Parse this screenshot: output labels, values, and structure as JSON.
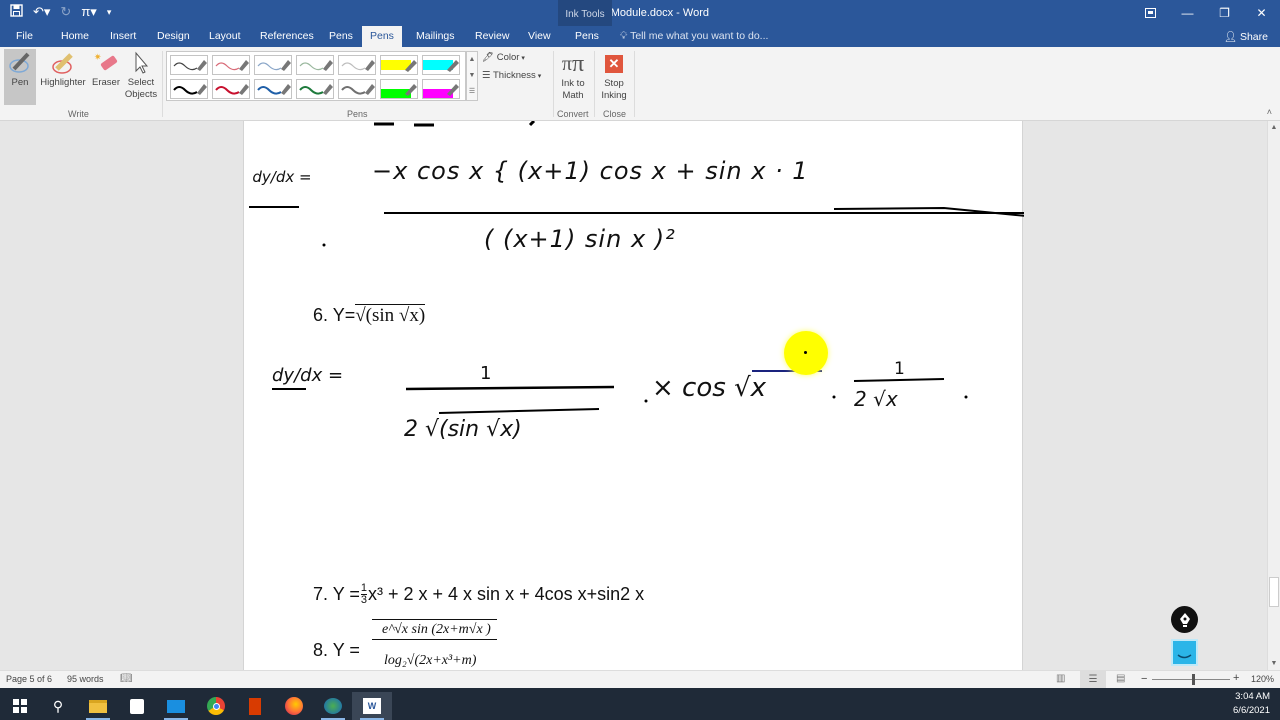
{
  "window": {
    "title": "2.Class Module.docx - Word",
    "context_tab_group": "Ink Tools",
    "controls": {
      "ribbon_display": "ribbon-display-icon",
      "minimize": "—",
      "restore": "❐",
      "close": "✕"
    }
  },
  "quick_access": {
    "save": "save-icon",
    "undo": "↶▾",
    "redo": "↻",
    "equation": "π▾",
    "customize": "▾"
  },
  "tabs": [
    {
      "label": "File"
    },
    {
      "label": "Home"
    },
    {
      "label": "Insert"
    },
    {
      "label": "Design"
    },
    {
      "label": "Layout"
    },
    {
      "label": "References"
    },
    {
      "label": "Pens"
    },
    {
      "label": "Pens",
      "active": true
    },
    {
      "label": "Mailings"
    },
    {
      "label": "Review"
    },
    {
      "label": "View"
    },
    {
      "label": "Pens"
    }
  ],
  "tell_me": {
    "placeholder": "Tell me what you want to do..."
  },
  "share_label": "Share",
  "ribbon": {
    "write": {
      "label": "Write",
      "buttons": [
        {
          "label": "Pen",
          "selected": true
        },
        {
          "label": "Highlighter"
        },
        {
          "label": "Eraser"
        },
        {
          "label": "Select Objects"
        }
      ]
    },
    "pens": {
      "label": "Pens",
      "row1": [
        "#444444",
        "#d96b78",
        "#8aa6c8",
        "#9ab89e",
        "#bdbdbd",
        "#ffff00",
        "#00ffff"
      ],
      "row2": [
        "#000000",
        "#c8102e",
        "#1f5fa8",
        "#1e7a3c",
        "#707070",
        "#00ff00",
        "#ff00ff"
      ],
      "highlighters": [
        5,
        6
      ],
      "color_label": "Color",
      "thickness_label": "Thickness"
    },
    "convert": {
      "label": "Convert",
      "button": "Ink to Math"
    },
    "close": {
      "label": "Close",
      "button": "Stop Inking"
    }
  },
  "document": {
    "ink_line1_lhs": "dy/dx =",
    "ink_line1_num": "−x cos x { (x+1) cos x + sin x · 1",
    "ink_line1_den": "( (x+1) sin x )²",
    "item6_label": "6. Y=",
    "item6_expr": "√(sin √x)",
    "ink_line2_lhs": "dy/dx =",
    "ink_line2_frac_num": "1",
    "ink_line2_frac_den": "2 √(sin √x)",
    "ink_line2_mid": "× cos √x",
    "ink_line2_frac2_num": "1",
    "ink_line2_frac2_den": "2 √x",
    "item7": "7. Y = ⅓x³ + 2 x + 4 x sin x + 4cos x+sin2 x",
    "item7_prefix": "7. Y = ",
    "item7_frac_num": "1",
    "item7_frac_den": "3",
    "item7_rest": "x³ + 2 x + 4 x sin x + 4cos x+sin2 x",
    "item8_prefix": "8. Y = ",
    "item8_num": "e^√x sin (2x+m√x )",
    "item8_den": "log₂√(2x+x³+m)"
  },
  "status": {
    "page": "Page 5 of 6",
    "words": "95 words",
    "zoom": "120%",
    "zoom_value": 120
  },
  "taskbar": {
    "apps": [
      "Start",
      "Search",
      "File Explorer",
      "Microsoft Store",
      "Mail",
      "Google Chrome",
      "Microsoft Office",
      "Firefox",
      "Internet Download Manager",
      "Word"
    ],
    "time": "3:04 AM",
    "date": "6/6/2021"
  },
  "colors": {
    "word_blue": "#2b579a",
    "ribbon_bg": "#f3f3f3",
    "cursor_highlight": "#ffff00",
    "stop_inking": "#e0563d",
    "float_button": "#2bb5e8"
  }
}
